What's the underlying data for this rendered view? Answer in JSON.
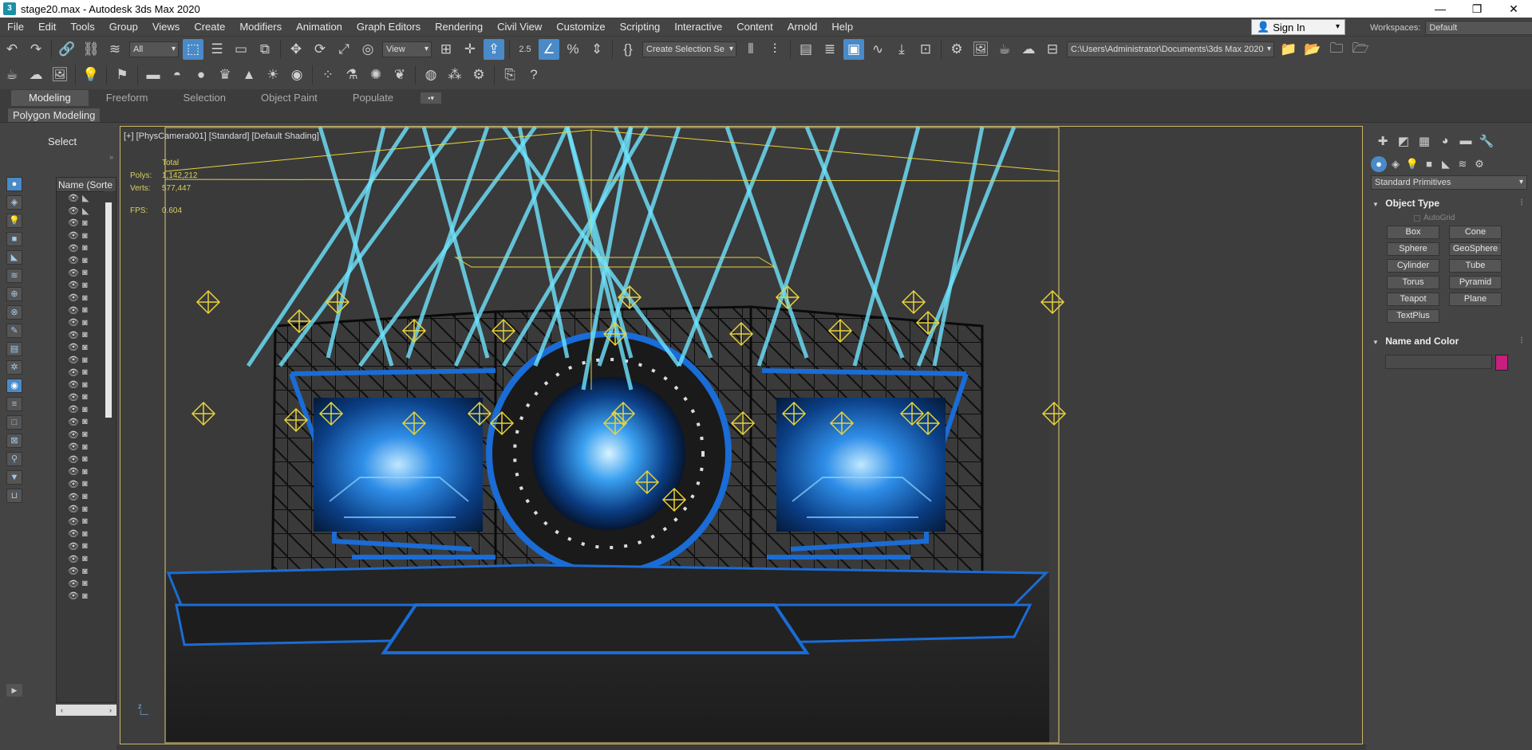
{
  "window": {
    "title": "stage20.max - Autodesk 3ds Max 2020",
    "controls": [
      "—",
      "❐",
      "✕"
    ]
  },
  "menu": [
    "File",
    "Edit",
    "Tools",
    "Group",
    "Views",
    "Create",
    "Modifiers",
    "Animation",
    "Graph Editors",
    "Rendering",
    "Civil View",
    "Customize",
    "Scripting",
    "Interactive",
    "Content",
    "Arnold",
    "Help"
  ],
  "account": {
    "signin_label": "Sign In"
  },
  "workspaces": {
    "label": "Workspaces:",
    "value": "Default"
  },
  "toolbar": {
    "selection_filter": "All",
    "ref_coord": "View",
    "named_selection": "Create Selection Se",
    "project_path": "C:\\Users\\Administrator\\Documents\\3ds Max 2020",
    "snap_label": "2.5"
  },
  "ribbon": {
    "tabs": [
      "Modeling",
      "Freeform",
      "Selection",
      "Object Paint",
      "Populate"
    ],
    "active_tab": "Modeling",
    "sub_label": "Polygon Modeling"
  },
  "explorer": {
    "select_label": "Select",
    "column_header": "Name (Sorte",
    "rows": 33
  },
  "viewport": {
    "label": "[+] [PhysCamera001] [Standard] [Default Shading]",
    "stats": {
      "total_label": "Total",
      "polys_label": "Polys:",
      "polys_value": "1,142,212",
      "verts_label": "Verts:",
      "verts_value": "577,447",
      "fps_label": "FPS:",
      "fps_value": "0.604"
    },
    "axis_label": "z"
  },
  "command_panel": {
    "primitive_type": "Standard Primitives",
    "object_type_title": "Object Type",
    "autogrid_label": "AutoGrid",
    "objects": [
      "Box",
      "Cone",
      "Sphere",
      "GeoSphere",
      "Cylinder",
      "Tube",
      "Torus",
      "Pyramid",
      "Teapot",
      "Plane",
      "TextPlus"
    ],
    "name_color_title": "Name and Color",
    "object_color": "#c81e7e"
  },
  "colors": {
    "laser": "#6fe4ff",
    "screen_blue": "#1a6cd6",
    "truss": "#0c0c0c",
    "light_gizmo": "#e8d23a",
    "selection_frame": "#c8b46a"
  }
}
